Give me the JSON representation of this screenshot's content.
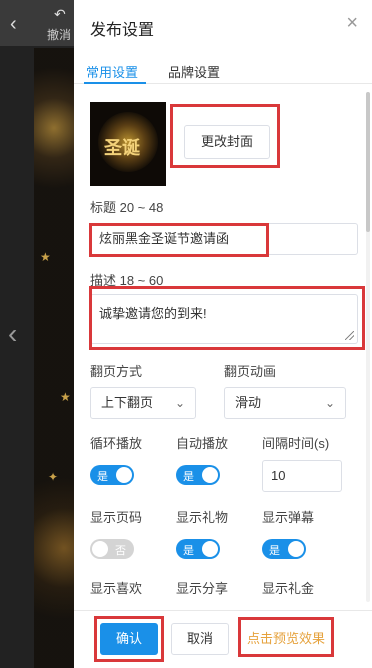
{
  "background": {
    "back_icon": "‹",
    "undo_icon": "↶",
    "undo_label": "撤消",
    "side_arrow": "‹"
  },
  "panel": {
    "title": "发布设置",
    "close_icon": "×"
  },
  "tabs": [
    {
      "label": "常用设置",
      "active": true
    },
    {
      "label": "品牌设置",
      "active": false
    }
  ],
  "cover": {
    "image_text": "圣诞",
    "change_button": "更改封面"
  },
  "title_field": {
    "label": "标题 20 ~ 48",
    "value": "炫丽黑金圣诞节邀请函"
  },
  "description_field": {
    "label": "描述 18 ~ 60",
    "value": "诚挚邀请您的到来!"
  },
  "page_turn": {
    "mode_label": "翻页方式",
    "mode_value": "上下翻页",
    "animation_label": "翻页动画",
    "animation_value": "滑动",
    "chevron": "⌄"
  },
  "settings": {
    "loop_label": "循环播放",
    "loop_state": "是",
    "autoplay_label": "自动播放",
    "autoplay_state": "是",
    "interval_label": "间隔时间(s)",
    "interval_value": "10",
    "show_page_label": "显示页码",
    "show_page_state": "否",
    "show_gift_label": "显示礼物",
    "show_gift_state": "是",
    "show_danmaku_label": "显示弹幕",
    "show_danmaku_state": "是",
    "show_like_label": "显示喜欢",
    "show_share_label": "显示分享",
    "show_cash_gift_label": "显示礼金"
  },
  "footer": {
    "confirm": "确认",
    "cancel": "取消",
    "preview": "点击预览效果"
  },
  "colors": {
    "accent": "#1a90e8",
    "highlight": "#d9383a",
    "preview": "#e6a23c"
  }
}
